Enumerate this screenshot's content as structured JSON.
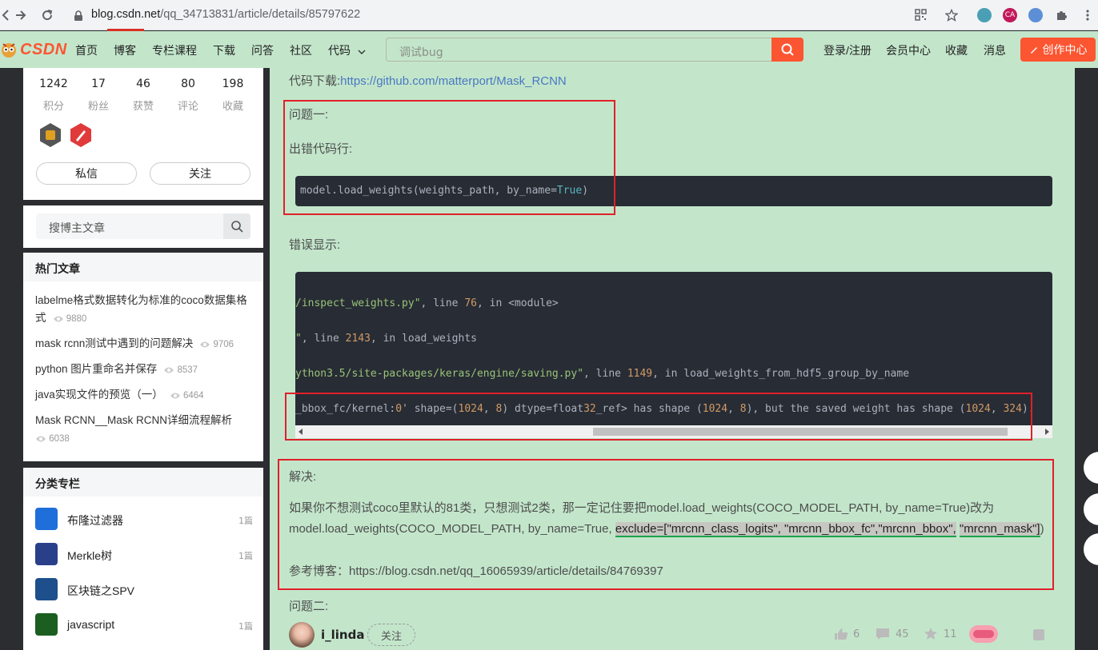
{
  "browser": {
    "url_domain": "blog.csdn.net",
    "url_path": "/qq_34713831/article/details/85797622",
    "extension_ca": "CA"
  },
  "navbar": {
    "logo_text": "CSDN",
    "items": [
      {
        "label": "首页"
      },
      {
        "label": "博客"
      },
      {
        "label": "专栏课程"
      },
      {
        "label": "下载"
      },
      {
        "label": "问答"
      },
      {
        "label": "社区"
      },
      {
        "label": "代码"
      }
    ],
    "search_placeholder": "调试bug",
    "login": "登录/注册",
    "vip": "会员中心",
    "favorites": "收藏",
    "messages": "消息",
    "create": "创作中心"
  },
  "profile": {
    "stats": [
      {
        "value": "1242",
        "label": "积分"
      },
      {
        "value": "17",
        "label": "粉丝"
      },
      {
        "value": "46",
        "label": "获赞"
      },
      {
        "value": "80",
        "label": "评论"
      },
      {
        "value": "198",
        "label": "收藏"
      }
    ],
    "message_button": "私信",
    "follow_button": "关注"
  },
  "blog_search": {
    "placeholder": "搜博主文章"
  },
  "hot_articles": {
    "title": "热门文章",
    "items": [
      {
        "title": "labelme格式数据转化为标准的coco数据集格式",
        "views": "9880"
      },
      {
        "title": "mask rcnn测试中遇到的问题解决",
        "views": "9706"
      },
      {
        "title": "python 图片重命名并保存",
        "views": "8537"
      },
      {
        "title": "java实现文件的预览（一）",
        "views": "6464"
      },
      {
        "title": "Mask RCNN__Mask RCNN详细流程解析",
        "views": "6038"
      }
    ]
  },
  "columns": {
    "title": "分类专栏",
    "items": [
      {
        "name": "布隆过滤器",
        "count": "1篇",
        "color": "#1e6fd9"
      },
      {
        "name": "Merkle树",
        "count": "1篇",
        "color": "#2a3f8a"
      },
      {
        "name": "区块链之SPV",
        "count": "",
        "color": "#1d4f8c"
      },
      {
        "name": "javascript",
        "count": "1篇",
        "color": "#1b5e20"
      }
    ]
  },
  "article": {
    "download_label": "代码下载:",
    "download_link": "https://github.com/matterport/Mask_RCNN",
    "problem1": "问题一:",
    "error_line_label": "出错代码行:",
    "error_display_label": "错误显示:",
    "solution_label": "解决:",
    "solution_part1": "如果你不想测试coco里默认的81类，只想测试2类，那一定记住要把model.load_weights(COCO_MODEL_PATH, by_name=True)改为model.load_weights(COCO_MODEL_PATH, by_name=True, ",
    "solution_hl1": "exclude=[\"mrcnn_class_logits\", \"mrcnn_bbox_fc\",\"mrcnn_bbox\",",
    "solution_hl2": "\"mrcnn_mask\"]",
    "solution_end": ")",
    "reference": "参考博客：https://blog.csdn.net/qq_16065939/article/details/84769397",
    "problem2": "问题二:"
  },
  "code1": {
    "a": "model.load_weights(weights_path, by_name=",
    "b": "True",
    "c": ")"
  },
  "code2": {
    "l1a": "/inspect_weights.py\"",
    "l1b": ", line ",
    "l1c": "76",
    "l1d": ", in <module>",
    "l2a": "\"",
    "l2b": ", line ",
    "l2c": "2143",
    "l2d": ", in load_weights",
    "l3a": "ython3.5/site-packages/keras/engine/saving.py\"",
    "l3b": ", line ",
    "l3c": "1149",
    "l3d": ", in load_weights_from_hdf5_group_by_name",
    "l4a": "_bbox_fc/kernel:",
    "l4b": "0",
    "l4c": "' shape=(",
    "l4d": "1024",
    "l4e": ", ",
    "l4f": "8",
    "l4g": ") dtype=float",
    "l4h": "32",
    "l4i": "_ref> has shape (",
    "l4j": "1024",
    "l4k": ", ",
    "l4l": "8",
    "l4m": "), but the saved weight has shape (",
    "l4n": "1024",
    "l4o": ", ",
    "l4p": "324",
    "l4q": ")."
  },
  "bottom": {
    "author": "i_linda",
    "follow": "关注",
    "likes": "6",
    "comments": "45",
    "stars": "11"
  }
}
